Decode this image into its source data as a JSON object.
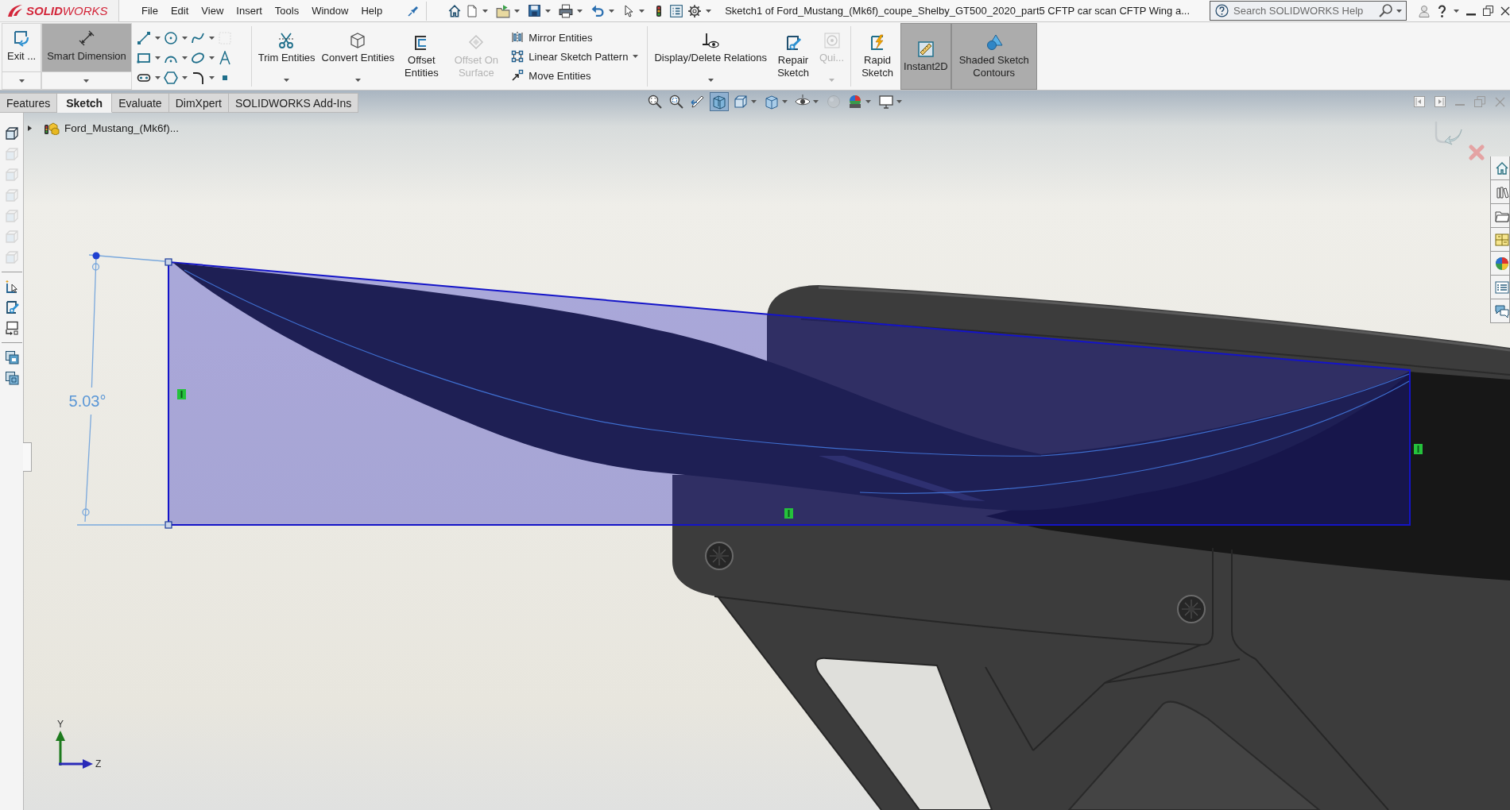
{
  "title_bar": {
    "logo": "**SOLID**WORKS",
    "menus": [
      "File",
      "Edit",
      "View",
      "Insert",
      "Tools",
      "Window",
      "Help"
    ],
    "document_title": "Sketch1 of Ford_Mustang_(Mk6f)_coupe_Shelby_GT500_2020_part5 CFTP car scan CFTP Wing a...",
    "search": {
      "placeholder": "Search SOLIDWORKS Help"
    }
  },
  "command_manager": [
    {
      "kind": "split",
      "label": "Exit ...",
      "on": false
    },
    {
      "kind": "split",
      "label": "Smart Dimension",
      "on": true
    },
    {
      "kind": "grid",
      "tools": [
        {
          "disabled": false,
          "dropdown": true
        },
        {
          "disabled": false,
          "dropdown": true
        },
        {
          "disabled": false,
          "dropdown": true
        },
        {
          "disabled": true,
          "dropdown": false
        },
        {
          "disabled": false,
          "dropdown": true
        },
        {
          "disabled": false,
          "dropdown": true
        },
        {
          "disabled": false,
          "dropdown": true
        },
        {
          "disabled": false,
          "dropdown": false
        },
        {
          "disabled": false,
          "dropdown": true
        },
        {
          "disabled": false,
          "dropdown": true
        },
        {
          "disabled": false,
          "dropdown": true
        },
        {
          "disabled": false,
          "dropdown": false
        }
      ]
    },
    {
      "kind": "separator"
    },
    {
      "kind": "large",
      "label": "Trim Entities",
      "on": false,
      "disabled": false,
      "dropdown": true
    },
    {
      "kind": "large",
      "label": "Convert Entities",
      "on": false,
      "disabled": false,
      "dropdown": true
    },
    {
      "kind": "large",
      "label": "Offset Entities",
      "on": false,
      "disabled": false,
      "dropdown": false
    },
    {
      "kind": "large",
      "label": "Offset On Surface",
      "on": false,
      "disabled": true,
      "dropdown": false
    },
    {
      "kind": "stack",
      "items": [
        {
          "label": "Mirror Entities",
          "dropdown": false
        },
        {
          "label": "Linear Sketch Pattern",
          "dropdown": true
        },
        {
          "label": "Move Entities",
          "dropdown": false
        }
      ]
    },
    {
      "kind": "separator"
    },
    {
      "kind": "large",
      "label": "Display/Delete Relations",
      "on": false,
      "disabled": false,
      "dropdown": true
    },
    {
      "kind": "large",
      "label": "Repair Sketch",
      "on": false,
      "disabled": false,
      "dropdown": false
    },
    {
      "kind": "large",
      "label": "Qui...",
      "on": false,
      "disabled": true,
      "dropdown": true
    },
    {
      "kind": "separator"
    },
    {
      "kind": "large",
      "label": "Rapid Sketch",
      "on": false,
      "disabled": false,
      "dropdown": false
    },
    {
      "kind": "large",
      "label": "Instant2D",
      "on": true,
      "disabled": false,
      "dropdown": false
    },
    {
      "kind": "large",
      "label": "Shaded Sketch Contours",
      "on": true,
      "disabled": false,
      "dropdown": false
    }
  ],
  "tabs": [
    {
      "label": "Features",
      "selected": false
    },
    {
      "label": "Sketch",
      "selected": true
    },
    {
      "label": "Evaluate",
      "selected": false
    },
    {
      "label": "DimXpert",
      "selected": false
    },
    {
      "label": "SOLIDWORKS Add-Ins",
      "selected": false
    }
  ],
  "heads_up_toolbar": [
    {
      "selected": false,
      "disabled": false,
      "dropdown": false
    },
    {
      "selected": false,
      "disabled": false,
      "dropdown": false
    },
    {
      "selected": false,
      "disabled": false,
      "dropdown": false
    },
    {
      "selected": true,
      "disabled": false,
      "dropdown": false
    },
    {
      "selected": false,
      "disabled": false,
      "dropdown": true
    },
    {
      "selected": false,
      "disabled": false,
      "dropdown": true
    },
    {
      "selected": false,
      "disabled": false,
      "dropdown": true
    },
    {
      "selected": false,
      "disabled": true,
      "dropdown": false
    },
    {
      "selected": false,
      "disabled": false,
      "dropdown": true
    },
    {
      "selected": false,
      "disabled": false,
      "dropdown": true
    }
  ],
  "feature_tree": {
    "label": "Ford_Mustang_(Mk6f)...",
    "expanded": false
  },
  "left_toolbar": [
    {
      "kind": "button",
      "disabled": false
    },
    {
      "kind": "button",
      "disabled": true
    },
    {
      "kind": "button",
      "disabled": true
    },
    {
      "kind": "button",
      "disabled": true
    },
    {
      "kind": "button",
      "disabled": true
    },
    {
      "kind": "button",
      "disabled": true
    },
    {
      "kind": "button",
      "disabled": true
    },
    {
      "kind": "separator"
    },
    {
      "kind": "button",
      "disabled": false
    },
    {
      "kind": "button",
      "disabled": false
    },
    {
      "kind": "button",
      "disabled": false
    },
    {
      "kind": "separator"
    },
    {
      "kind": "button",
      "disabled": false
    },
    {
      "kind": "button",
      "disabled": false
    }
  ],
  "viewport": {
    "dimension": "5.03°",
    "triad": {
      "y_label": "Y",
      "z_label": "Z"
    }
  }
}
